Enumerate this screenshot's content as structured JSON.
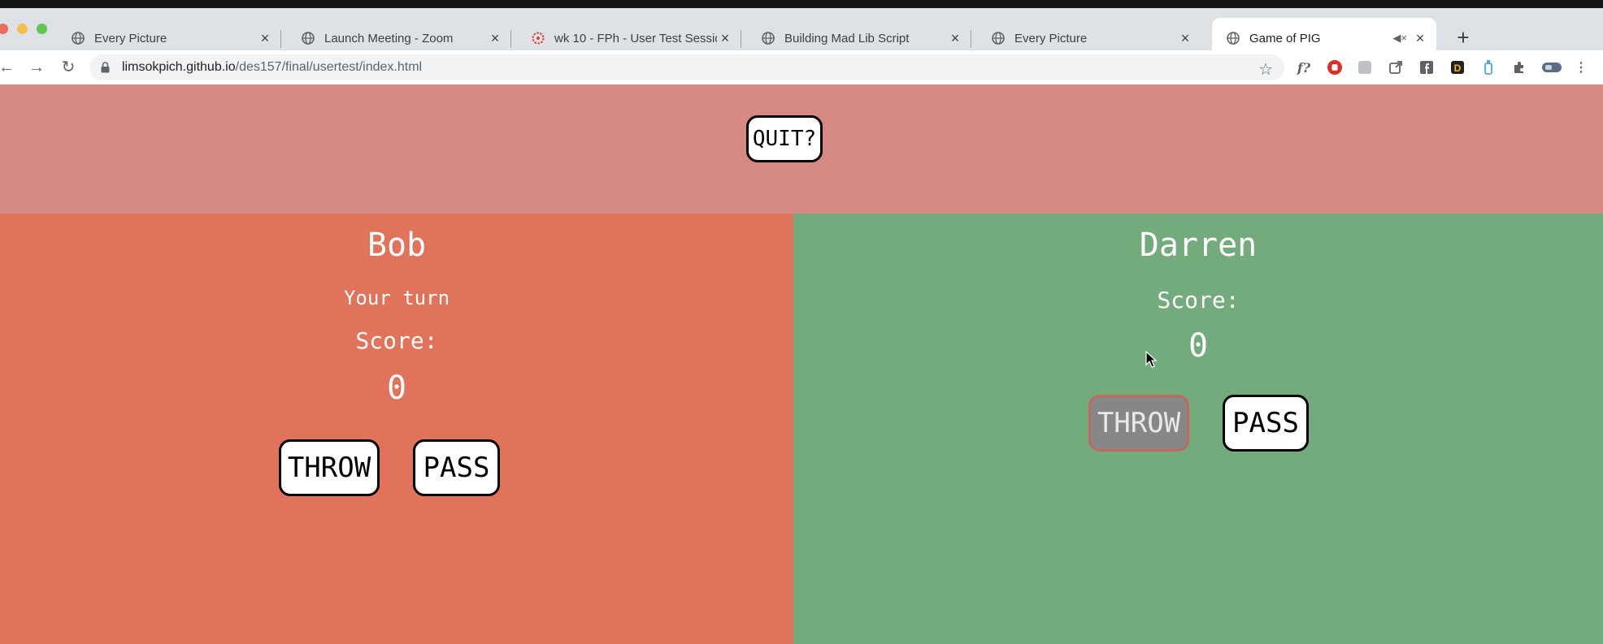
{
  "browser": {
    "tabs": [
      {
        "title": "Every Picture",
        "icon": "globe-icon",
        "active": false
      },
      {
        "title": "Launch Meeting - Zoom",
        "icon": "globe-icon",
        "active": false
      },
      {
        "title": "wk 10 - FPh - User Test Session",
        "icon": "canvas-icon",
        "active": false
      },
      {
        "title": "Building Mad Lib Script",
        "icon": "globe-icon",
        "active": false
      },
      {
        "title": "Every Picture",
        "icon": "globe-icon",
        "active": false
      },
      {
        "title": "Game of PIG",
        "icon": "globe-icon",
        "active": true,
        "muted": true
      }
    ],
    "url_host": "limsokpich.github.io",
    "url_path": "/des157/final/usertest/index.html",
    "colors": {
      "tabstrip": "#dee1e6",
      "omnibox": "#f1f3f4"
    }
  },
  "game": {
    "quit_label": "QUIT?",
    "player1": {
      "name": "Bob",
      "message": "Your turn",
      "score_label": "Score:",
      "score": "0",
      "throw_label": "THROW",
      "pass_label": "PASS",
      "color": "#e07359"
    },
    "player2": {
      "name": "Darren",
      "score_label": "Score:",
      "score": "0",
      "throw_label": "THROW",
      "pass_label": "PASS",
      "color": "#73ab7c"
    },
    "header_color": "#d68883"
  }
}
